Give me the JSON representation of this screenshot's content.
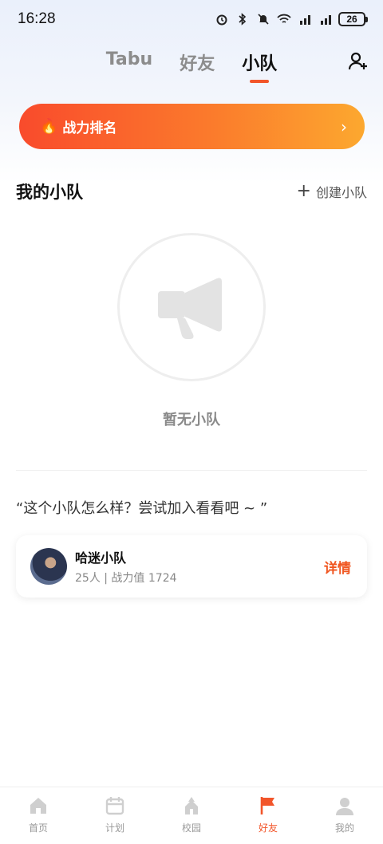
{
  "status_bar": {
    "time": "16:28",
    "icons": [
      "alarm-icon",
      "bluetooth-icon",
      "mute-icon",
      "wifi-icon",
      "signal-4g-icon",
      "signal-4g-icon"
    ],
    "battery": "26"
  },
  "header": {
    "tabs": [
      {
        "label": "Tabu",
        "active": false
      },
      {
        "label": "好友",
        "active": false
      },
      {
        "label": "小队",
        "active": true
      }
    ],
    "add_friend_icon": "add-user-icon"
  },
  "banner": {
    "title": "战力排名",
    "icon": "fire-icon",
    "arrow": "›"
  },
  "my_team": {
    "title": "我的小队",
    "create_label": "创建小队",
    "empty_text": "暂无小队"
  },
  "suggestion": {
    "text": "“这个小队怎么样？尝试加入看看吧 ~ ”"
  },
  "team_card": {
    "name": "哈迷小队",
    "meta": "25人 | 战力值 1724",
    "detail_label": "详情"
  },
  "bottom_nav": [
    {
      "label": "首页",
      "icon": "home-icon",
      "active": false
    },
    {
      "label": "计划",
      "icon": "calendar-icon",
      "active": false
    },
    {
      "label": "校园",
      "icon": "campus-icon",
      "active": false
    },
    {
      "label": "好友",
      "icon": "flag-icon",
      "active": true
    },
    {
      "label": "我的",
      "icon": "profile-icon",
      "active": false
    }
  ],
  "colors": {
    "accent": "#f2552a",
    "banner_start": "#f94b2c",
    "banner_end": "#fca82f",
    "muted": "#999999"
  }
}
